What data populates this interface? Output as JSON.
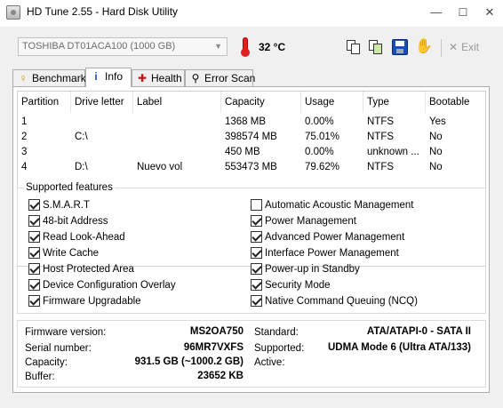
{
  "window": {
    "title": "HD Tune 2.55 - Hard Disk Utility"
  },
  "toolbar": {
    "drive": "TOSHIBA DT01ACA100 (1000 GB)",
    "temperature": "32 °C",
    "exit_label": "Exit"
  },
  "tabs": [
    {
      "label": "Benchmark"
    },
    {
      "label": "Info"
    },
    {
      "label": "Health"
    },
    {
      "label": "Error Scan"
    }
  ],
  "partitions": {
    "headers": [
      "Partition",
      "Drive letter",
      "Label",
      "Capacity",
      "Usage",
      "Type",
      "Bootable"
    ],
    "rows": [
      [
        "1",
        "",
        "",
        "1368 MB",
        "0.00%",
        "NTFS",
        "Yes"
      ],
      [
        "2",
        "C:\\",
        "",
        "398574 MB",
        "75.01%",
        "NTFS",
        "No"
      ],
      [
        "3",
        "",
        "",
        "450 MB",
        "0.00%",
        "unknown ...",
        "No"
      ],
      [
        "4",
        "D:\\",
        "Nuevo vol",
        "553473 MB",
        "79.62%",
        "NTFS",
        "No"
      ]
    ]
  },
  "features": {
    "title": "Supported features",
    "left": [
      {
        "label": "S.M.A.R.T",
        "checked": true
      },
      {
        "label": "48-bit Address",
        "checked": true
      },
      {
        "label": "Read Look-Ahead",
        "checked": true
      },
      {
        "label": "Write Cache",
        "checked": true
      },
      {
        "label": "Host Protected Area",
        "checked": true
      },
      {
        "label": "Device Configuration Overlay",
        "checked": true
      },
      {
        "label": "Firmware Upgradable",
        "checked": true
      }
    ],
    "right": [
      {
        "label": "Automatic Acoustic Management",
        "checked": false
      },
      {
        "label": "Power Management",
        "checked": true
      },
      {
        "label": "Advanced Power Management",
        "checked": true
      },
      {
        "label": "Interface Power Management",
        "checked": true
      },
      {
        "label": "Power-up in Standby",
        "checked": true
      },
      {
        "label": "Security Mode",
        "checked": true
      },
      {
        "label": "Native Command Queuing (NCQ)",
        "checked": true
      }
    ]
  },
  "details": {
    "firmware_label": "Firmware version:",
    "firmware": "MS2OA750",
    "serial_label": "Serial number:",
    "serial": "96MR7VXFS",
    "capacity_label": "Capacity:",
    "capacity": "931.5 GB (~1000.2 GB)",
    "buffer_label": "Buffer:",
    "buffer": "23652 KB",
    "standard_label": "Standard:",
    "standard": "ATA/ATAPI-0 - SATA II",
    "supported_label": "Supported:",
    "supported": "UDMA Mode 6 (Ultra ATA/133)",
    "active_label": "Active:",
    "active": ""
  },
  "colors": {
    "temperature": "#e02020",
    "accent_blue": "#1a4fb8"
  }
}
